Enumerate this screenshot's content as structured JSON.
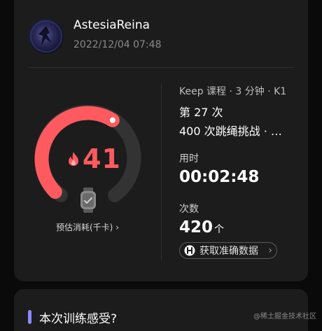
{
  "profile": {
    "username": "AstesiaReina",
    "datetime": "2022/12/04 07:48"
  },
  "summary": {
    "calories": "41",
    "calories_progress": 0.62,
    "estimate_label": "预估消耗(千卡)",
    "estimate_chevron": "›"
  },
  "course": {
    "meta": "Keep 课程 · 3 分钟 · K1",
    "session": "第 27 次",
    "name": "400 次跳绳挑战 · …"
  },
  "stats": {
    "duration_label": "用时",
    "duration_value": "00:02:48",
    "count_label": "次数",
    "count_value": "420",
    "count_unit": "个"
  },
  "get_data_button": {
    "label": "获取准确数据",
    "chevron": "›"
  },
  "feeling": {
    "title": "本次训练感受?"
  },
  "watermark": "@稀土掘金技术社区",
  "icons": {
    "flame": "flame-icon",
    "watch": "watch-icon",
    "data": "data-badge-icon"
  },
  "colors": {
    "accent": "#ff5a5f",
    "track": "#333333",
    "feeling_bar": "#8a8aff"
  }
}
